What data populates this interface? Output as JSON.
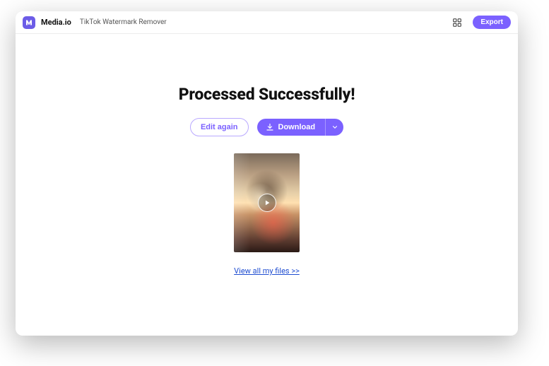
{
  "header": {
    "brand": "Media.io",
    "tool": "TikTok Watermark Remover",
    "export_label": "Export"
  },
  "main": {
    "title": "Processed Successfully!",
    "edit_again_label": "Edit again",
    "download_label": "Download",
    "view_files_label": "View all my files >>"
  },
  "icons": {
    "logo": "media-logo",
    "grid": "apps-grid-icon",
    "download": "download-icon",
    "chevron_down": "chevron-down-icon",
    "play": "play-icon"
  },
  "colors": {
    "accent": "#7b61ff"
  }
}
